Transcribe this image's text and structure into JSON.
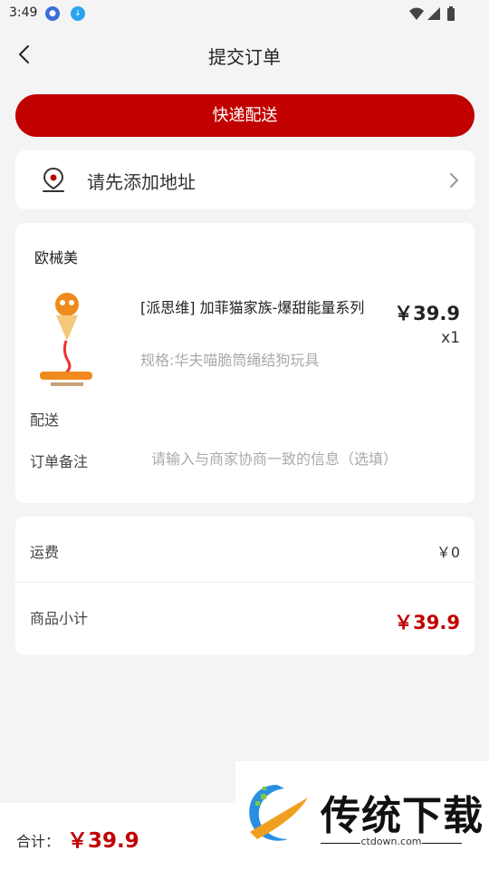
{
  "status": {
    "time": "3:49"
  },
  "nav": {
    "title": "提交订单"
  },
  "delivery": {
    "label": "快递配送"
  },
  "address": {
    "prompt": "请先添加地址"
  },
  "order": {
    "shop_name": "欧械美",
    "product": {
      "title": "[派思维] 加菲猫家族-爆甜能量系列",
      "price": "￥39.9",
      "qty": "x1",
      "spec": "规格:华夫喵脆筒绳结狗玩具"
    },
    "delivery_label": "配送",
    "remark_label": "订单备注",
    "remark_placeholder": "请输入与商家协商一致的信息（选填）"
  },
  "summary": {
    "shipping_label": "运费",
    "shipping_value": "￥0",
    "subtotal_label": "商品小计",
    "subtotal_value": "￥39.9"
  },
  "footer": {
    "total_label": "合计：",
    "total_value": "￥39.9"
  },
  "watermark": {
    "text": "传统下载",
    "domain": "ctdown.com"
  },
  "colors": {
    "accent": "#c10000",
    "background": "#f4f4f4"
  },
  "icons": [
    "back-icon",
    "location-icon",
    "chevron-right-icon",
    "wifi-icon",
    "signal-icon",
    "battery-icon"
  ]
}
